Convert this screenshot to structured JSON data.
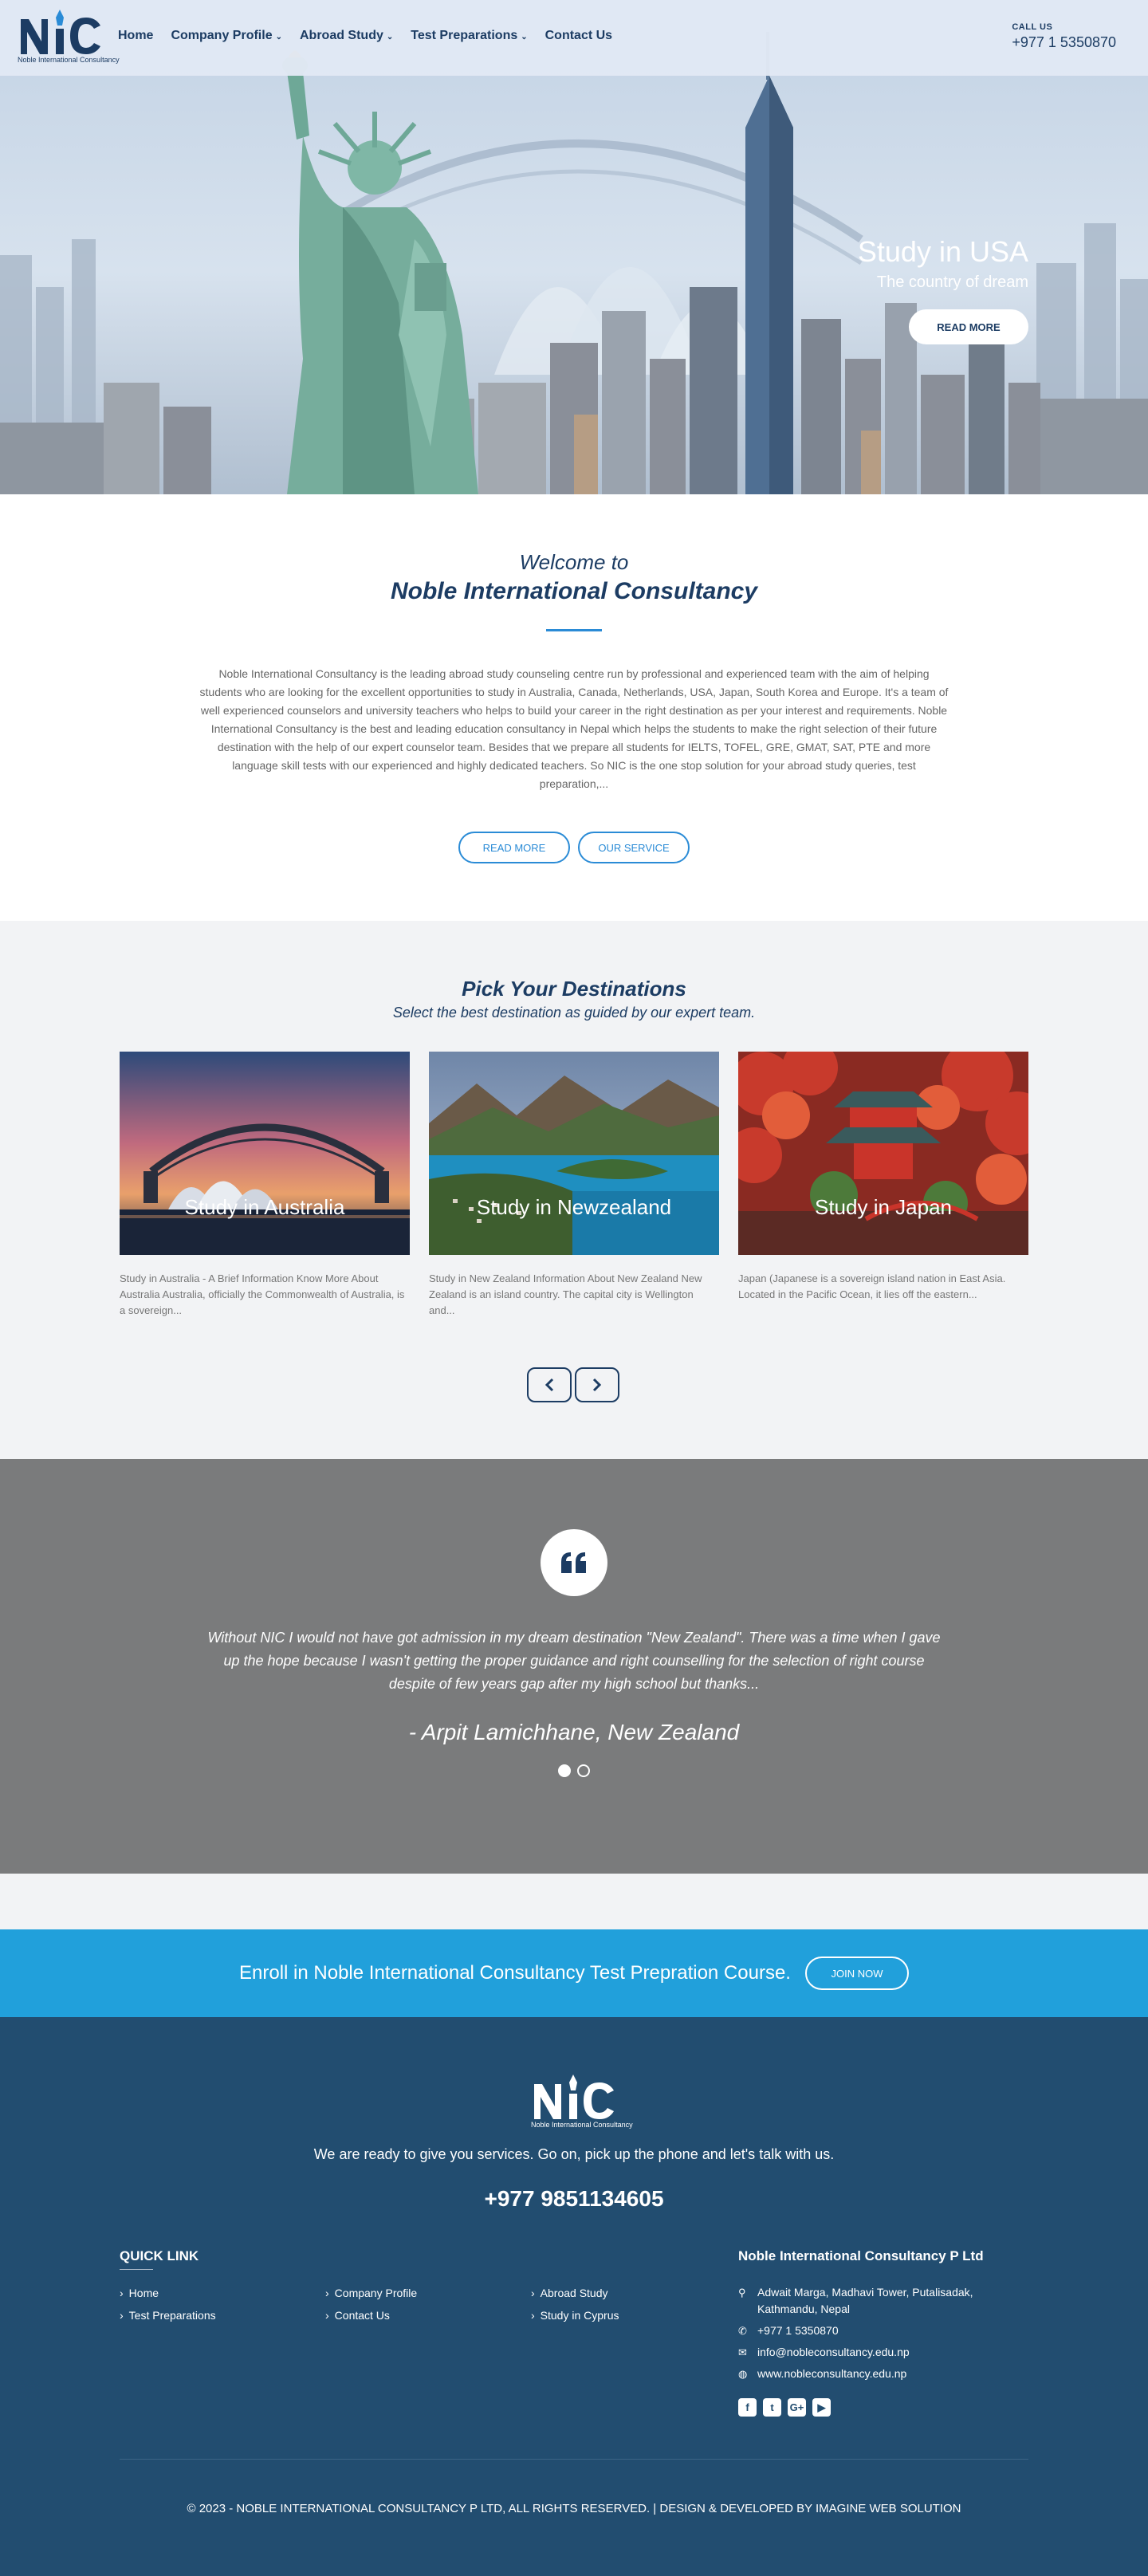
{
  "header": {
    "logo_text": "Noble International Consultancy",
    "nav": [
      {
        "label": "Home",
        "dropdown": false
      },
      {
        "label": "Company Profile",
        "dropdown": true
      },
      {
        "label": "Abroad Study",
        "dropdown": true
      },
      {
        "label": "Test Preparations",
        "dropdown": true
      },
      {
        "label": "Contact Us",
        "dropdown": false
      }
    ],
    "call_label": "CALL US",
    "call_phone": "+977 1 5350870"
  },
  "hero": {
    "title": "Study in USA",
    "subtitle": "The country of dream",
    "button": "READ MORE"
  },
  "welcome": {
    "pre": "Welcome to",
    "title": "Noble International Consultancy",
    "text": "Noble International Consultancy is the leading abroad study counseling centre run by professional and experienced team with the aim of helping students who are looking for the excellent opportunities to study in Australia, Canada, Netherlands, USA, Japan, South Korea and Europe. It's a team of well experienced counselors and university teachers who helps to build your career in the right destination as per your interest and requirements. Noble International Consultancy is the best and leading education consultancy in Nepal which helps the students to make the right selection of their future destination with the help of our expert counselor team. Besides that we prepare all students for IELTS, TOFEL, GRE, GMAT, SAT, PTE and more language skill tests with our experienced and highly dedicated teachers. So NIC is the one stop solution for your abroad study queries, test preparation,...",
    "btn_read_more": "READ MORE",
    "btn_our_service": "OUR SERVICE"
  },
  "destinations": {
    "title": "Pick Your Destinations",
    "subtitle": "Select the best destination as guided by our expert team.",
    "cards": [
      {
        "label": "Study in Australia",
        "text": "Study in Australia - A Brief Information Know More About Australia Australia, officially the Commonwealth of Australia, is a sovereign..."
      },
      {
        "label": "Study in Newzealand",
        "text": "Study in New Zealand Information About New Zealand New Zealand is an island country. The capital city is Wellington and..."
      },
      {
        "label": "Study in Japan",
        "text": "Japan (Japanese is a sovereign island nation in East Asia. Located in the Pacific Ocean, it lies off the eastern..."
      }
    ],
    "prev_icon": "chevron-left-icon",
    "next_icon": "chevron-right-icon"
  },
  "testimonial": {
    "text": "Without NIC I would not have got admission in my dream destination \"New Zealand\". There was a time when I gave up the hope because I wasn't getting the proper guidance and right counselling for the selection of right course despite of few years gap after my high school but thanks...",
    "author": "- Arpit Lamichhane, New Zealand",
    "slides": 2,
    "active_slide": 1
  },
  "enroll": {
    "text": "Enroll in Noble International Consultancy Test Prepration Course.",
    "button": "JOIN NOW"
  },
  "footer": {
    "logo_text": "Noble International Consultancy",
    "tagline": "We are ready to give you services. Go on, pick up the phone and let's talk with us.",
    "phone": "+977 9851134605",
    "quick_link_title": "QUICK LINK",
    "quick_links": [
      "Home",
      "Company Profile",
      "Abroad Study",
      "Test Preparations",
      "Contact Us",
      "Study in Cyprus"
    ],
    "company_title": "Noble International Consultancy P Ltd",
    "address": "Adwait Marga, Madhavi Tower, Putalisadak, Kathmandu, Nepal",
    "phone_office": "+977 1 5350870",
    "email": "info@nobleconsultancy.edu.np",
    "website": "www.nobleconsultancy.edu.np",
    "socials": [
      "facebook-icon",
      "twitter-icon",
      "google-plus-icon",
      "youtube-icon"
    ],
    "copyright": "© 2023 - NOBLE INTERNATIONAL CONSULTANCY P LTD, ALL RIGHTS RESERVED.  |  DESIGN & DEVELOPED BY IMAGINE WEB SOLUTION"
  },
  "colors": {
    "navy": "#1c3c63",
    "accent_blue": "#2a8bd6",
    "enroll_blue": "#21a0db",
    "footer_bg": "#224d70",
    "testimonial_bg": "#7a7b7c"
  }
}
